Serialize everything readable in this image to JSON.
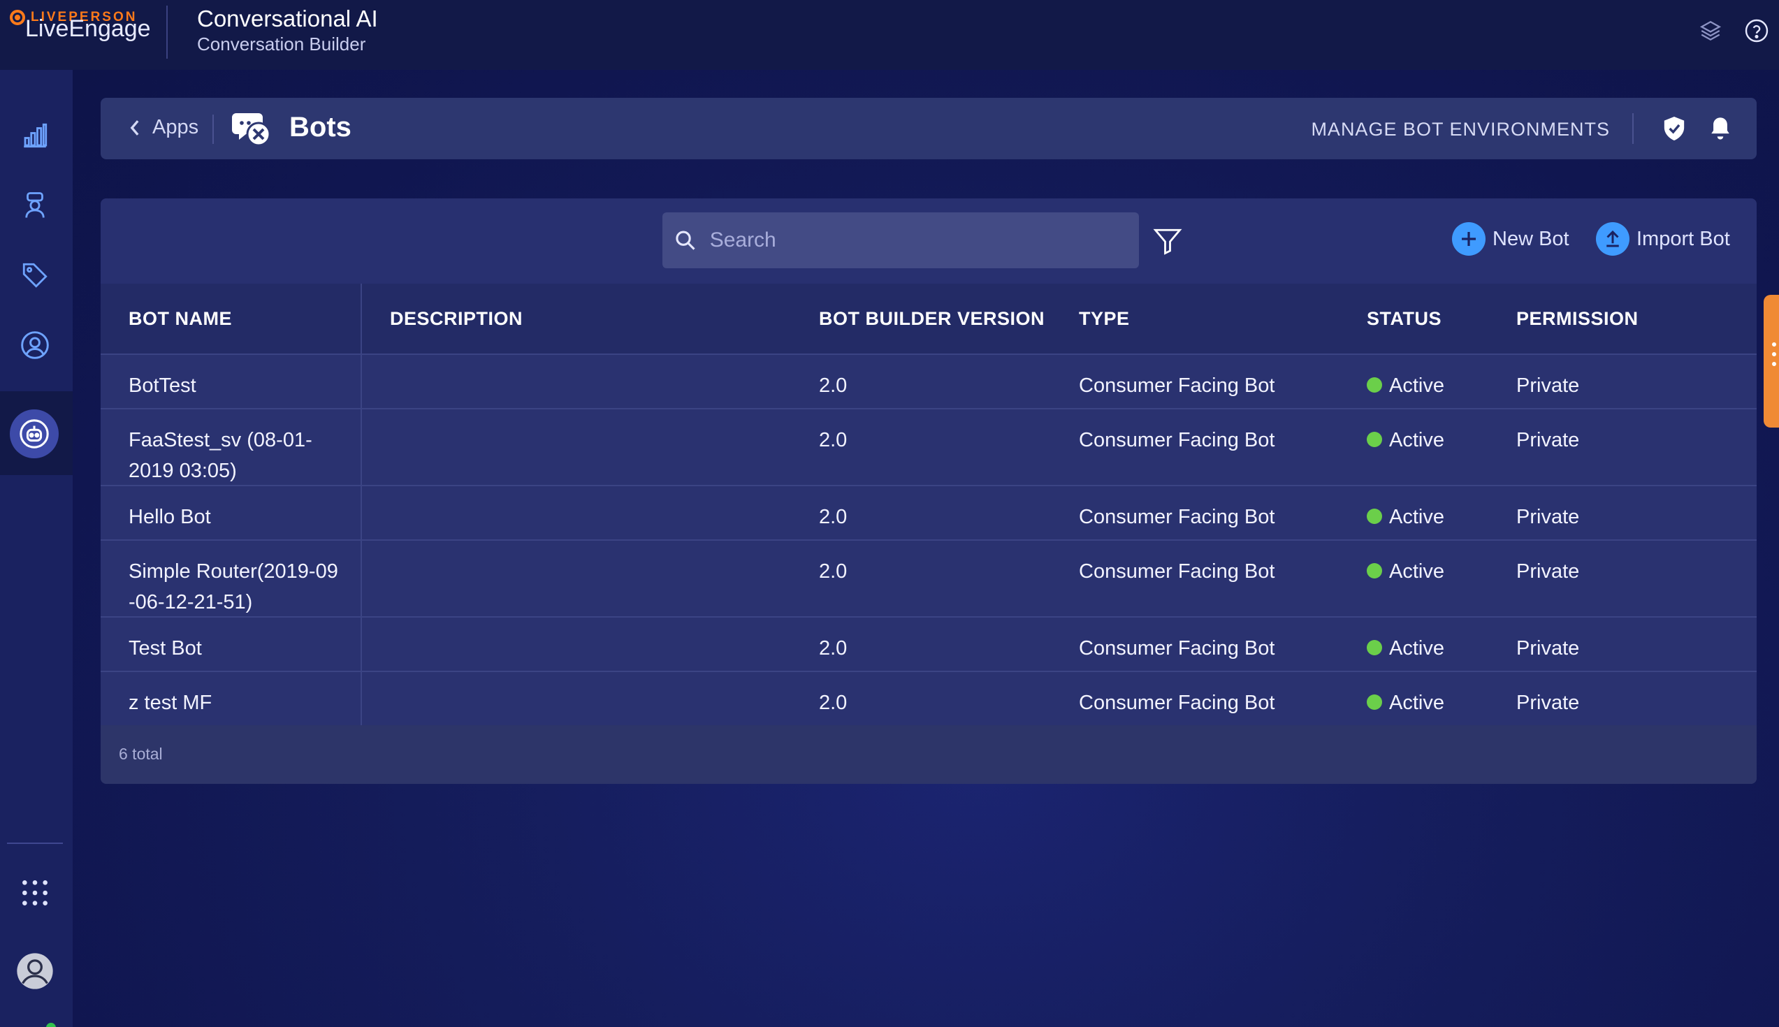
{
  "header": {
    "brand_small": "LIVEPERSON",
    "brand_big": "LiveEngage",
    "app_title": "Conversational AI",
    "app_subtitle": "Conversation Builder",
    "icons": [
      "layers-icon",
      "help-icon"
    ]
  },
  "leftnav": {
    "items": [
      "analytics-icon",
      "agent-icon",
      "tag-icon",
      "user-icon",
      "bot-icon"
    ],
    "active": "bot-icon",
    "bottom": [
      "apps-grid-icon",
      "avatar-icon"
    ]
  },
  "page_header": {
    "back_label": "Apps",
    "title": "Bots",
    "manage_label": "MANAGE BOT ENVIRONMENTS",
    "icons": [
      "shield-icon",
      "bell-icon"
    ]
  },
  "toolbar": {
    "search_placeholder": "Search",
    "new_bot_label": "New Bot",
    "import_bot_label": "Import Bot"
  },
  "table": {
    "columns": [
      "BOT NAME",
      "DESCRIPTION",
      "BOT BUILDER VERSION",
      "TYPE",
      "STATUS",
      "PERMISSION"
    ],
    "rows": [
      {
        "name": "BotTest",
        "description": "",
        "version": "2.0",
        "type": "Consumer Facing Bot",
        "status": "Active",
        "permission": "Private"
      },
      {
        "name": "FaaStest_sv (08-01-2019 03:05)",
        "description": "",
        "version": "2.0",
        "type": "Consumer Facing Bot",
        "status": "Active",
        "permission": "Private"
      },
      {
        "name": "Hello Bot",
        "description": "",
        "version": "2.0",
        "type": "Consumer Facing Bot",
        "status": "Active",
        "permission": "Private"
      },
      {
        "name": "Simple Router(2019-09-06-12-21-51)",
        "description": "",
        "version": "2.0",
        "type": "Consumer Facing Bot",
        "status": "Active",
        "permission": "Private"
      },
      {
        "name": "Test Bot",
        "description": "",
        "version": "2.0",
        "type": "Consumer Facing Bot",
        "status": "Active",
        "permission": "Private"
      },
      {
        "name": "z test MF",
        "description": "",
        "version": "2.0",
        "type": "Consumer Facing Bot",
        "status": "Active",
        "permission": "Private"
      }
    ],
    "total_label": "6 total"
  },
  "colors": {
    "status_active": "#6bcf4a",
    "accent_blue": "#3f9bff",
    "brand_orange": "#ff7a1a"
  }
}
